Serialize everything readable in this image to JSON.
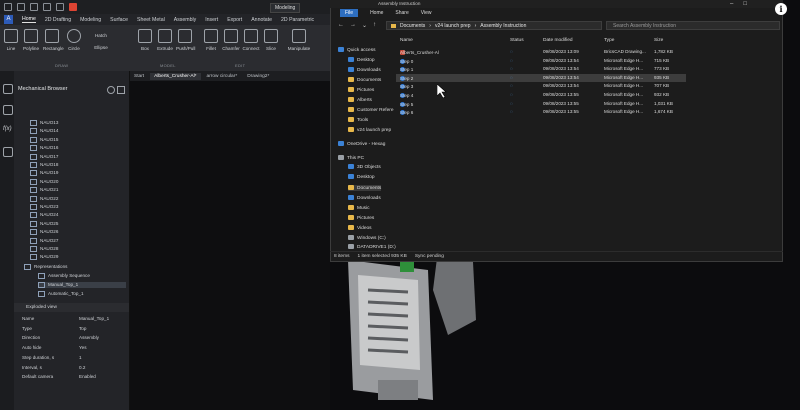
{
  "cad": {
    "workspace": "Modeling",
    "app_letter": "A",
    "ribbon_tabs": [
      "Home",
      "2D Drafting",
      "Modeling",
      "Surface",
      "Sheet Metal",
      "Assembly",
      "Insert",
      "Export",
      "Annotate",
      "2D Parametric"
    ],
    "tools": [
      "Line",
      "Polyline",
      "Rectangle",
      "Circle",
      "Hatch",
      "Ellipse",
      "Box",
      "Extrude",
      "Push/Pull",
      "Fillet",
      "Chamfer",
      "Connect",
      "Slice",
      "Manipulate"
    ],
    "groups": [
      "DRAW",
      "MODEL",
      "EDIT"
    ],
    "browser_title": "Mechanical Browser",
    "tree_items": [
      "NAUO13",
      "NAUO14",
      "NAUO15",
      "NAUO16",
      "NAUO17",
      "NAUO18",
      "NAUO19",
      "NAUO20",
      "NAUO21",
      "NAUO22",
      "NAUO23",
      "NAUO24",
      "NAUO25",
      "NAUO26",
      "NAUO27",
      "NAUO28",
      "NAUO29"
    ],
    "representations": "Representations",
    "assembly_sequence": "Assembly Sequence",
    "manual_top": "Manual_Top_1",
    "automatic_top": "Automatic_Top_1",
    "exploded_view": "Exploded view",
    "props": [
      {
        "k": "Name",
        "v": "Manual_Top_1"
      },
      {
        "k": "Type",
        "v": "Top"
      },
      {
        "k": "Direction",
        "v": "Assembly"
      },
      {
        "k": "Auto hide",
        "v": "Yes"
      },
      {
        "k": "Step duration, s",
        "v": "1"
      },
      {
        "k": "Interval, s",
        "v": "0.2"
      },
      {
        "k": "Default camera",
        "v": "Enabled"
      }
    ],
    "doc_tabs": [
      "Start",
      "Alberts_Crusher-Al*",
      "arrow circular*",
      "Drawing2*"
    ]
  },
  "explorer": {
    "title": "Assembly Instruction",
    "menu": [
      "File",
      "Home",
      "Share",
      "View"
    ],
    "path": [
      "Documents",
      "v24 launch prep",
      "Assembly Instruction"
    ],
    "search_placeholder": "Search Assembly Instruction",
    "nav": [
      "Quick access",
      "Desktop",
      "Downloads",
      "Documents",
      "Pictures",
      "Alberts",
      "Customer Refere",
      "Tools",
      "v24 launch prep",
      "OneDrive - Hexag",
      "This PC",
      "3D Objects",
      "Desktop",
      "Documents",
      "Downloads",
      "Music",
      "Pictures",
      "Videos",
      "Windows (C:)",
      "DATADRIVE1 (D:)"
    ],
    "columns": [
      "Name",
      "Status",
      "Date modified",
      "Type",
      "Size"
    ],
    "files": [
      {
        "name": "Alberts_Crusher-Al",
        "date": "09/08/2023 13:09",
        "type": "BricsCAD Drawing...",
        "size": "1,782 KB"
      },
      {
        "name": "Step 0",
        "date": "09/08/2023 13:54",
        "type": "Microsoft Edge H...",
        "size": "715 KB"
      },
      {
        "name": "Step 1",
        "date": "09/08/2023 13:54",
        "type": "Microsoft Edge H...",
        "size": "773 KB"
      },
      {
        "name": "Step 2",
        "date": "09/08/2023 13:54",
        "type": "Microsoft Edge H...",
        "size": "935 KB"
      },
      {
        "name": "Step 3",
        "date": "09/08/2023 13:54",
        "type": "Microsoft Edge H...",
        "size": "707 KB"
      },
      {
        "name": "Step 4",
        "date": "09/08/2023 13:55",
        "type": "Microsoft Edge H...",
        "size": "932 KB"
      },
      {
        "name": "Step 5",
        "date": "09/08/2023 13:55",
        "type": "Microsoft Edge H...",
        "size": "1,031 KB"
      },
      {
        "name": "Step 6",
        "date": "09/08/2023 13:55",
        "type": "Microsoft Edge H...",
        "size": "1,674 KB"
      }
    ],
    "status_items": "8 items",
    "status_selected": "1 item selected  935 KB",
    "status_sync": "Sync pending"
  },
  "colors": {
    "accent": "#2d6ec0",
    "selected": "#3d3d3d"
  }
}
